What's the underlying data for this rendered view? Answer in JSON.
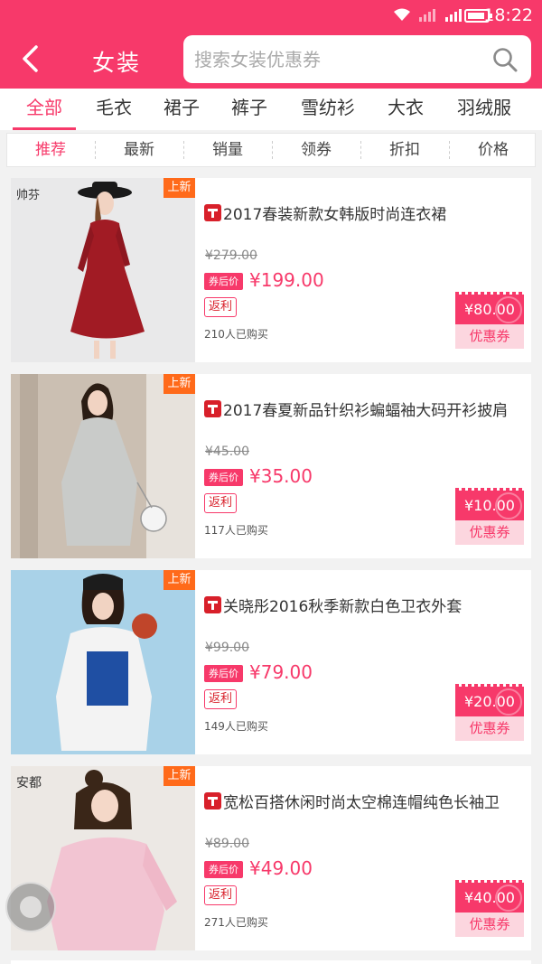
{
  "status": {
    "time": "18:22",
    "icons": [
      "wifi-icon",
      "signal-icon",
      "signal-icon",
      "battery-icon"
    ]
  },
  "header": {
    "title": "女装",
    "back_icon": "chevron-left-icon",
    "search_placeholder": "搜索女装优惠券",
    "search_icon": "search-icon",
    "color": "#f7396a"
  },
  "categories": [
    {
      "label": "全部",
      "active": true
    },
    {
      "label": "毛衣"
    },
    {
      "label": "裙子"
    },
    {
      "label": "裤子"
    },
    {
      "label": "雪纺衫"
    },
    {
      "label": "大衣"
    },
    {
      "label": "羽绒服"
    }
  ],
  "sort": [
    {
      "label": "推荐",
      "active": true
    },
    {
      "label": "最新"
    },
    {
      "label": "销量"
    },
    {
      "label": "领券"
    },
    {
      "label": "折扣"
    },
    {
      "label": "价格"
    }
  ],
  "labels": {
    "new": "上新",
    "coupon_price": "券后价",
    "rebate": "返利",
    "coupon": "优惠券"
  },
  "products": [
    {
      "title": "2017春装新款女韩版时尚连衣裙",
      "original_price": "¥279.00",
      "after_coupon_price": "¥199.00",
      "coupon_value": "¥80.00",
      "sold": "210人已购买",
      "brand": "帅芬"
    },
    {
      "title": "2017春夏新品针织衫蝙蝠袖大码开衫披肩",
      "original_price": "¥45.00",
      "after_coupon_price": "¥35.00",
      "coupon_value": "¥10.00",
      "sold": "117人已购买"
    },
    {
      "title": "关晓彤2016秋季新款白色卫衣外套",
      "original_price": "¥99.00",
      "after_coupon_price": "¥79.00",
      "coupon_value": "¥20.00",
      "sold": "149人已购买"
    },
    {
      "title": "宽松百搭休闲时尚太空棉连帽纯色长袖卫",
      "original_price": "¥89.00",
      "after_coupon_price": "¥49.00",
      "coupon_value": "¥40.00",
      "sold": "271人已购买",
      "brand": "安都"
    }
  ]
}
